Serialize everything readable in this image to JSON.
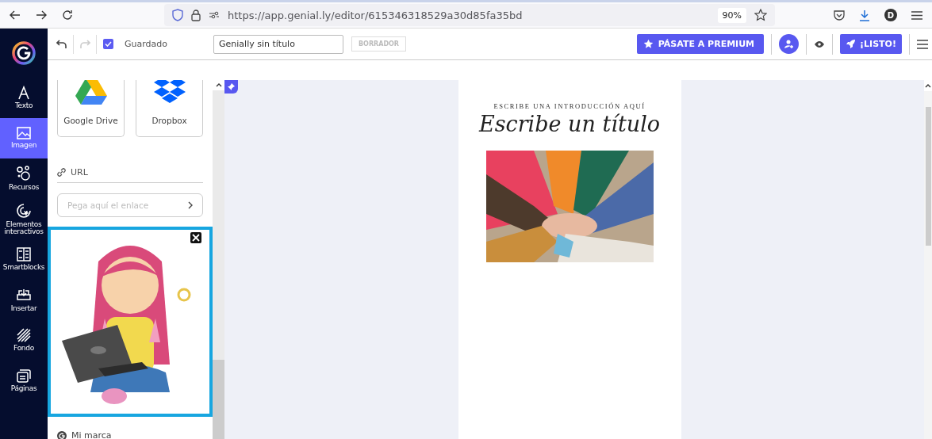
{
  "browser": {
    "url": "https://app.genial.ly/editor/615346318529a30d85fa35bd",
    "zoom": "90%",
    "profile_initial": "D"
  },
  "toolbar": {
    "saved": {
      "label": "Guardado",
      "checked": true
    },
    "title": "Genially sin título",
    "status": "BORRADOR",
    "premium": "PÁSATE A PREMIUM",
    "done": "¡LISTO!"
  },
  "nav": [
    {
      "label": "Texto",
      "selected": false
    },
    {
      "label": "Imagen",
      "selected": true
    },
    {
      "label": "Recursos",
      "selected": false
    },
    {
      "label": "Elementos interactivos",
      "selected": false
    },
    {
      "label": "Smartblocks",
      "selected": false
    },
    {
      "label": "Insertar",
      "selected": false
    },
    {
      "label": "Fondo",
      "selected": false
    },
    {
      "label": "Páginas",
      "selected": false
    }
  ],
  "panel": {
    "sources": [
      {
        "label": "Google Drive"
      },
      {
        "label": "Dropbox"
      }
    ],
    "url_label": "URL",
    "url_placeholder": "Pega aquí el enlace",
    "brand_label": "Mi marca"
  },
  "slide": {
    "intro": "ESCRIBE UNA INTRODUCCIÓN AQUÍ",
    "title": "Escribe un título"
  }
}
